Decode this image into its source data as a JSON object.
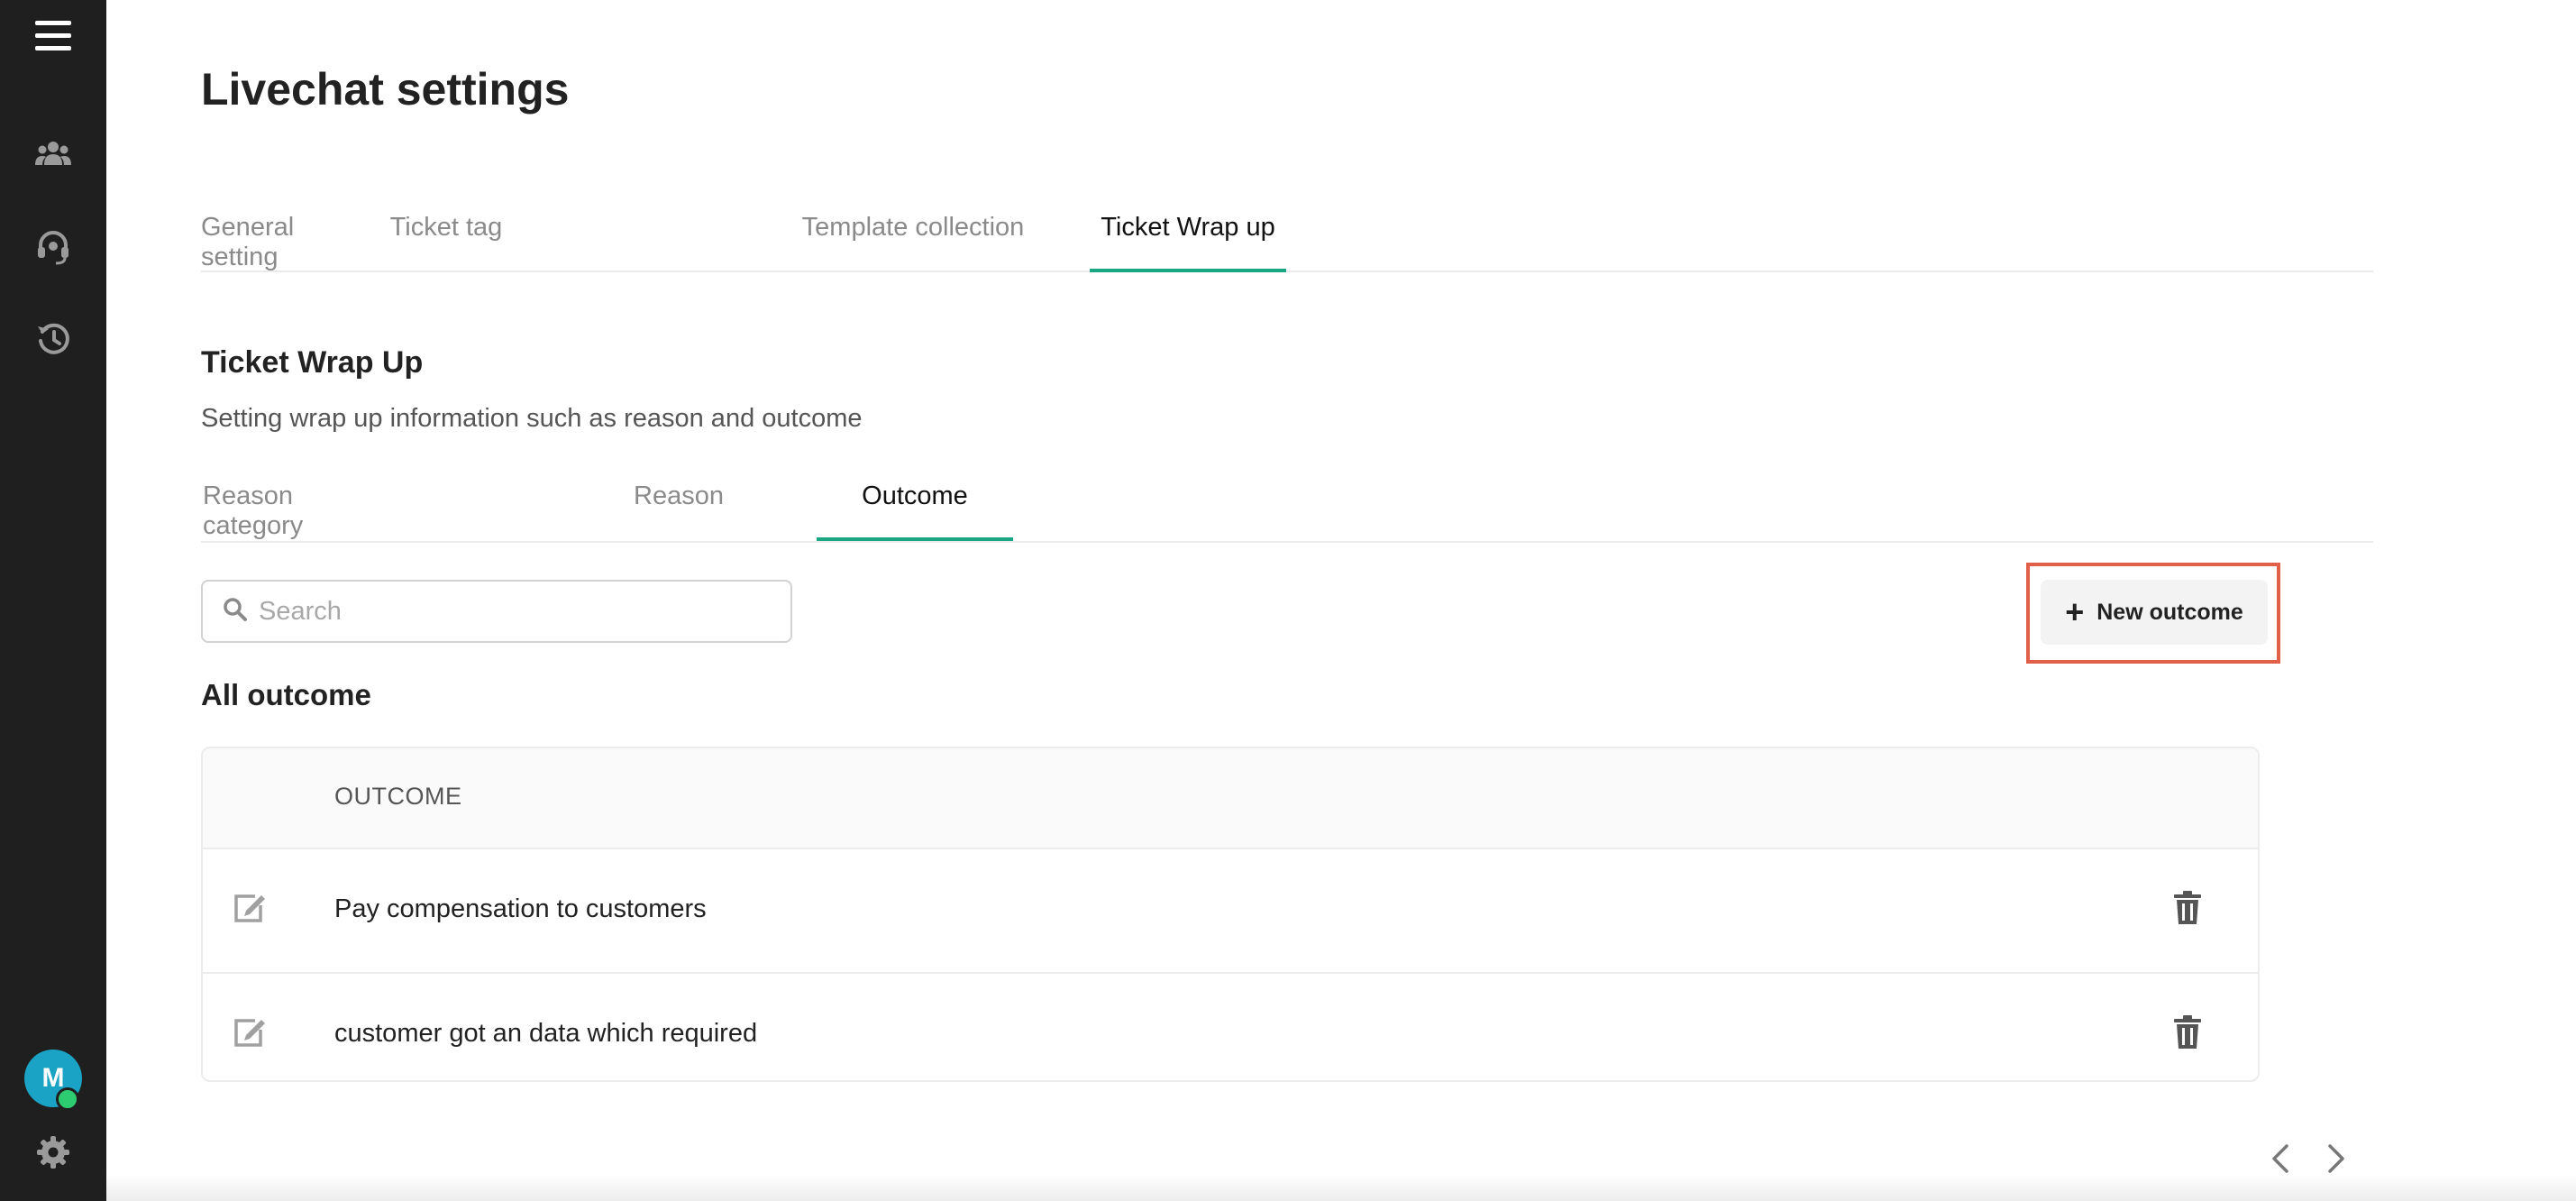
{
  "sidebar": {
    "icons": [
      "menu-icon",
      "team-icon",
      "headset-icon",
      "history-icon",
      "gear-icon"
    ],
    "avatar": {
      "initial": "M",
      "color": "#1aa3c4",
      "status_color": "#2ecc71"
    }
  },
  "page": {
    "title": "Livechat settings"
  },
  "tabs": [
    {
      "label": "General setting",
      "active": false
    },
    {
      "label": "Ticket tag",
      "active": false
    },
    {
      "label": "Template collection",
      "active": false
    },
    {
      "label": "Ticket Wrap up",
      "active": true
    }
  ],
  "section": {
    "title": "Ticket Wrap Up",
    "description": "Setting wrap up information such as reason and outcome"
  },
  "subtabs": [
    {
      "label": "Reason category",
      "active": false
    },
    {
      "label": "Reason",
      "active": false
    },
    {
      "label": "Outcome",
      "active": true
    }
  ],
  "search": {
    "placeholder": "Search",
    "value": ""
  },
  "new_button": {
    "label": "New outcome"
  },
  "list": {
    "title": "All outcome",
    "column_header": "OUTCOME",
    "rows": [
      {
        "outcome": "Pay compensation to customers"
      },
      {
        "outcome": "customer got an data which required"
      }
    ]
  },
  "colors": {
    "accent": "#1aa583",
    "highlight": "#e0604a",
    "sidebar": "#1f1f1f"
  }
}
